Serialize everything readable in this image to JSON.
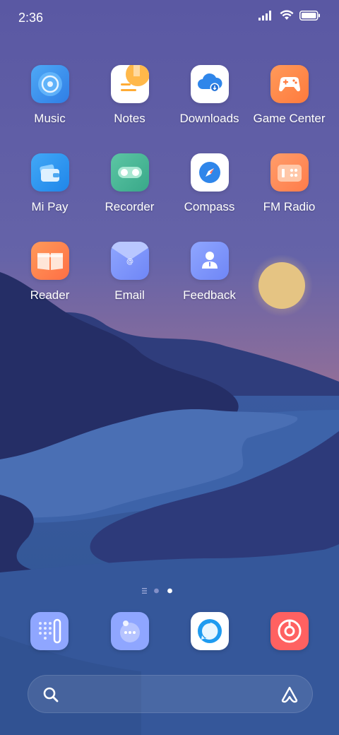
{
  "status_bar": {
    "time": "2:36",
    "signal_icon": "signal-bars-icon",
    "wifi_icon": "wifi-icon",
    "battery_icon": "battery-icon"
  },
  "apps": [
    {
      "label": "Music",
      "icon": "music-disc-icon"
    },
    {
      "label": "Notes",
      "icon": "notes-icon"
    },
    {
      "label": "Downloads",
      "icon": "cloud-download-icon"
    },
    {
      "label": "Game Center",
      "icon": "gamepad-icon"
    },
    {
      "label": "Mi Pay",
      "icon": "wallet-icon"
    },
    {
      "label": "Recorder",
      "icon": "recorder-icon"
    },
    {
      "label": "Compass",
      "icon": "compass-icon"
    },
    {
      "label": "FM Radio",
      "icon": "radio-icon"
    },
    {
      "label": "Reader",
      "icon": "book-icon"
    },
    {
      "label": "Email",
      "icon": "envelope-icon"
    },
    {
      "label": "Feedback",
      "icon": "feedback-person-icon"
    }
  ],
  "page_indicator": {
    "pages": 2,
    "current": 2,
    "list_icon": "page-list-icon"
  },
  "dock": [
    {
      "icon": "phone-dialer-icon"
    },
    {
      "icon": "messaging-icon"
    },
    {
      "icon": "browser-icon"
    },
    {
      "icon": "app-store-icon"
    }
  ],
  "search_bar": {
    "search_icon": "search-icon",
    "assistant_icon": "assistant-icon"
  },
  "colors": {
    "sky_top": "#5b5aa3",
    "sky_bottom": "#8a6f9a",
    "sun": "#e5c483",
    "water": "#3a5aa0"
  }
}
